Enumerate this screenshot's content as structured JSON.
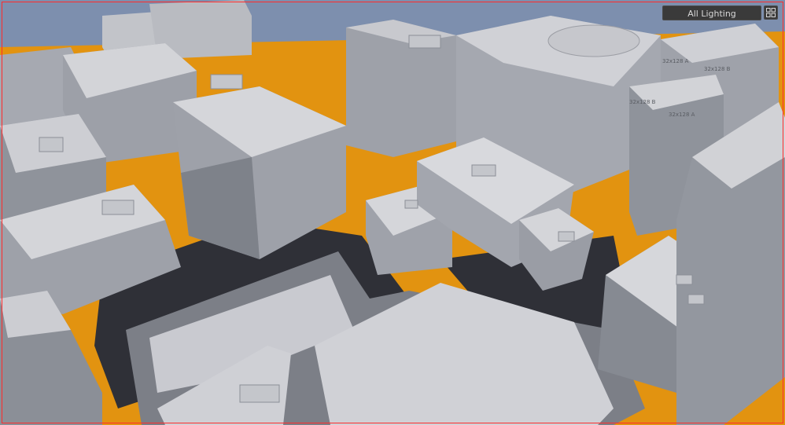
{
  "viewport": {
    "lighting_mode": "All Lighting",
    "layout_icon": "viewport-layout-grid-icon"
  },
  "colors": {
    "ground": "#e29310",
    "ground_dark": "#a86a08",
    "roof": "#d2d3d7",
    "wall_light": "#a9acb4",
    "wall_dark": "#737881",
    "shadow": "#3d3f46",
    "selection_border": "#ff2b2b"
  },
  "roof_labels": [
    "32x128 A",
    "32x128 B",
    "32x128 B",
    "32x128 A"
  ]
}
